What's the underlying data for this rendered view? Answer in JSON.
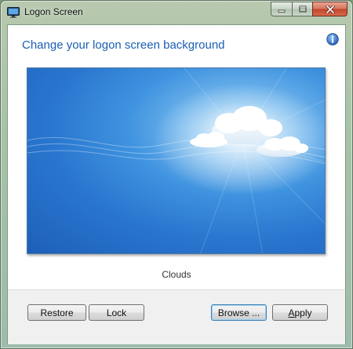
{
  "window": {
    "title": "Logon Screen",
    "app_icon": "monitor-icon",
    "caption_buttons": [
      "minimize-icon",
      "maximize-icon",
      "close-icon"
    ]
  },
  "content": {
    "heading": "Change your logon screen background",
    "info_icon": "info-icon",
    "preview_alt": "clouds-background-preview",
    "preview_caption": "Clouds"
  },
  "buttons": {
    "restore": "Restore",
    "lock": "Lock",
    "browse": "Browse ...",
    "apply_prefix": "",
    "apply_underlined": "A",
    "apply_suffix": "pply"
  },
  "colors": {
    "heading": "#1a5fb4",
    "preview_sky": "#2a77d0"
  }
}
